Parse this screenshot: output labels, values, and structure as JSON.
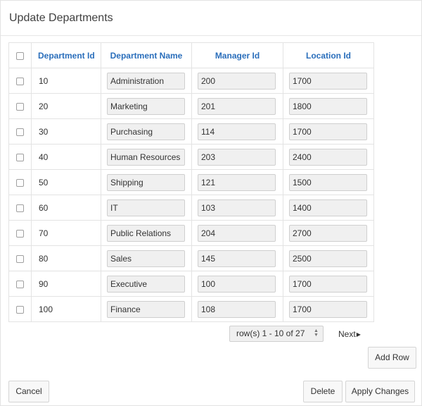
{
  "region": {
    "title": "Update Departments"
  },
  "table": {
    "columns": {
      "dept_id": "Department Id",
      "dept_name": "Department Name",
      "manager_id": "Manager Id",
      "location_id": "Location Id"
    },
    "rows": [
      {
        "id": "10",
        "name": "Administration",
        "manager": "200",
        "location": "1700"
      },
      {
        "id": "20",
        "name": "Marketing",
        "manager": "201",
        "location": "1800"
      },
      {
        "id": "30",
        "name": "Purchasing",
        "manager": "114",
        "location": "1700"
      },
      {
        "id": "40",
        "name": "Human Resources",
        "manager": "203",
        "location": "2400"
      },
      {
        "id": "50",
        "name": "Shipping",
        "manager": "121",
        "location": "1500"
      },
      {
        "id": "60",
        "name": "IT",
        "manager": "103",
        "location": "1400"
      },
      {
        "id": "70",
        "name": "Public Relations",
        "manager": "204",
        "location": "2700"
      },
      {
        "id": "80",
        "name": "Sales",
        "manager": "145",
        "location": "2500"
      },
      {
        "id": "90",
        "name": "Executive",
        "manager": "100",
        "location": "1700"
      },
      {
        "id": "100",
        "name": "Finance",
        "manager": "108",
        "location": "1700"
      }
    ]
  },
  "pagination": {
    "range_label": "row(s) 1 - 10 of 27",
    "next_label": "Next"
  },
  "buttons": {
    "add_row": "Add Row",
    "cancel": "Cancel",
    "delete": "Delete",
    "apply": "Apply Changes"
  },
  "icons": {
    "next": "triangle-right-icon",
    "select_arrows": "up-down-arrows-icon"
  },
  "colors": {
    "header_text": "#2a6ebb",
    "input_bg": "#f0f0f0"
  }
}
